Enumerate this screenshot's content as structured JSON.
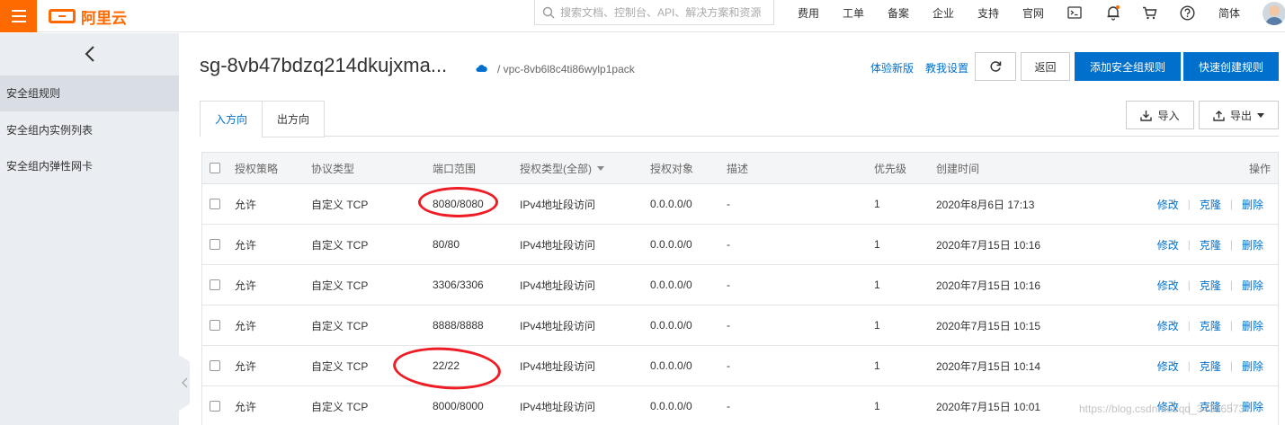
{
  "topbar": {
    "logo_text": "阿里云",
    "search_placeholder": "搜索文档、控制台、API、解决方案和资源",
    "nav": [
      "费用",
      "工单",
      "备案",
      "企业",
      "支持",
      "官网"
    ],
    "lang": "简体",
    "icons": [
      "terminal-icon",
      "bell-icon",
      "cart-icon",
      "help-icon"
    ]
  },
  "sidebar": {
    "items": [
      {
        "label": "安全组规则"
      },
      {
        "label": "安全组内实例列表"
      },
      {
        "label": "安全组内弹性网卡"
      }
    ]
  },
  "header": {
    "title": "sg-8vb47bdzq214dkujxma...",
    "vpc": "/ vpc-8vb6l8c4ti86wylp1pack",
    "try_new": "体验新版",
    "teach": "教我设置",
    "back": "返回",
    "add_rule": "添加安全组规则",
    "quick_create": "快速创建规则"
  },
  "tabs": [
    "入方向",
    "出方向"
  ],
  "toolbar": {
    "import": "导入",
    "export": "导出"
  },
  "table": {
    "columns": [
      "授权策略",
      "协议类型",
      "端口范围",
      "授权类型(全部)",
      "授权对象",
      "描述",
      "优先级",
      "创建时间",
      "操作"
    ],
    "rows": [
      {
        "policy": "允许",
        "protocol": "自定义 TCP",
        "port": "8080/8080",
        "auth_type": "IPv4地址段访问",
        "target": "0.0.0.0/0",
        "desc": "-",
        "priority": "1",
        "created": "2020年8月6日 17:13"
      },
      {
        "policy": "允许",
        "protocol": "自定义 TCP",
        "port": "80/80",
        "auth_type": "IPv4地址段访问",
        "target": "0.0.0.0/0",
        "desc": "-",
        "priority": "1",
        "created": "2020年7月15日 10:16"
      },
      {
        "policy": "允许",
        "protocol": "自定义 TCP",
        "port": "3306/3306",
        "auth_type": "IPv4地址段访问",
        "target": "0.0.0.0/0",
        "desc": "-",
        "priority": "1",
        "created": "2020年7月15日 10:16"
      },
      {
        "policy": "允许",
        "protocol": "自定义 TCP",
        "port": "8888/8888",
        "auth_type": "IPv4地址段访问",
        "target": "0.0.0.0/0",
        "desc": "-",
        "priority": "1",
        "created": "2020年7月15日 10:15"
      },
      {
        "policy": "允许",
        "protocol": "自定义 TCP",
        "port": "22/22",
        "auth_type": "IPv4地址段访问",
        "target": "0.0.0.0/0",
        "desc": "-",
        "priority": "1",
        "created": "2020年7月15日 10:14"
      },
      {
        "policy": "允许",
        "protocol": "自定义 TCP",
        "port": "8000/8000",
        "auth_type": "IPv4地址段访问",
        "target": "0.0.0.0/0",
        "desc": "-",
        "priority": "1",
        "created": "2020年7月15日 10:01"
      }
    ],
    "actions": {
      "edit": "修改",
      "clone": "克隆",
      "delete": "删除"
    }
  },
  "watermark": "https://blog.csdn.net/qq_34316573",
  "colors": {
    "brand": "#ff6a00",
    "primary": "#0070cc",
    "annotation": "#ee1c24"
  }
}
